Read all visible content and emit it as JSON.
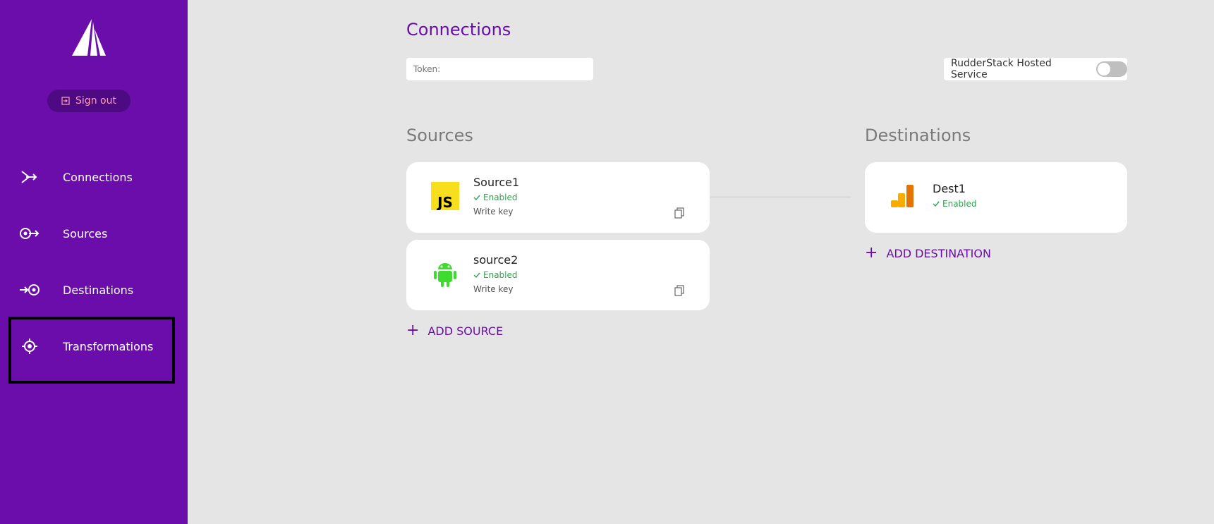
{
  "sidebar": {
    "signout_label": "Sign out",
    "items": [
      {
        "label": "Connections",
        "icon": "connections-icon"
      },
      {
        "label": "Sources",
        "icon": "sources-icon"
      },
      {
        "label": "Destinations",
        "icon": "destinations-icon"
      },
      {
        "label": "Transformations",
        "icon": "transformations-icon"
      }
    ]
  },
  "header": {
    "title": "Connections",
    "token_label": "Token:",
    "hosted_label": "RudderStack Hosted Service",
    "hosted_enabled": false
  },
  "sources": {
    "title": "Sources",
    "items": [
      {
        "name": "Source1",
        "status": "Enabled",
        "write_key_label": "Write key ",
        "icon": "javascript-icon"
      },
      {
        "name": "source2",
        "status": "Enabled",
        "write_key_label": "Write key",
        "icon": "android-icon"
      }
    ],
    "add_label": "ADD SOURCE"
  },
  "destinations": {
    "title": "Destinations",
    "items": [
      {
        "name": "Dest1",
        "status": "Enabled",
        "icon": "google-analytics-icon"
      }
    ],
    "add_label": "ADD DESTINATION"
  },
  "colors": {
    "sidebar": "#6a0dab",
    "accent": "#6a0dab",
    "enabled": "#2ea44f",
    "signout_text": "#ff9fb4"
  }
}
